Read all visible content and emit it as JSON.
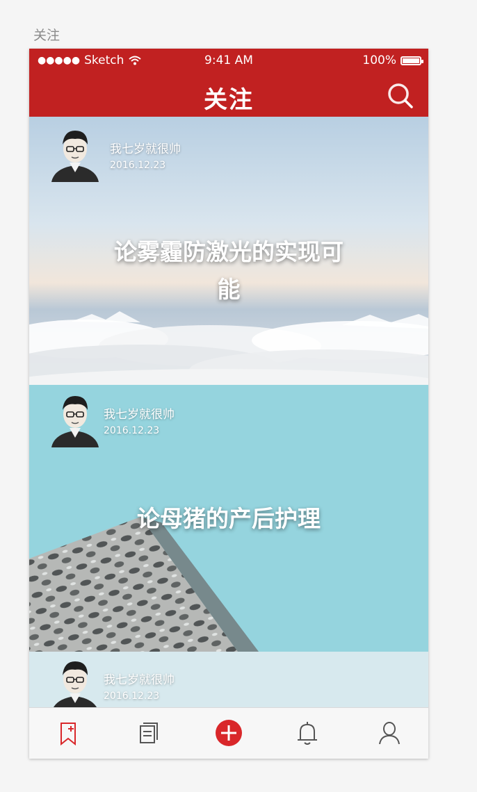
{
  "artboard": {
    "label": "关注"
  },
  "status_bar": {
    "signal": "●●●●●",
    "carrier": "Sketch",
    "time": "9:41 AM",
    "battery": "100%"
  },
  "nav": {
    "title": "关注",
    "search_icon": "search-icon"
  },
  "feed": [
    {
      "author": "我七岁就很帅",
      "date": "2016.12.23",
      "headline_line1": "论雾霾防激光的实现可",
      "headline_line2": "能"
    },
    {
      "author": "我七岁就很帅",
      "date": "2016.12.23",
      "headline": "论母猪的产后护理"
    },
    {
      "author": "我七岁就很帅",
      "date": "2016.12.23"
    }
  ],
  "tab_bar": {
    "items": [
      "bookmark-add-icon",
      "documents-icon",
      "add-post-icon",
      "bell-icon",
      "profile-icon"
    ],
    "active_color": "#d9272a",
    "inactive_color": "#555555"
  },
  "colors": {
    "brand": "#c12121"
  }
}
